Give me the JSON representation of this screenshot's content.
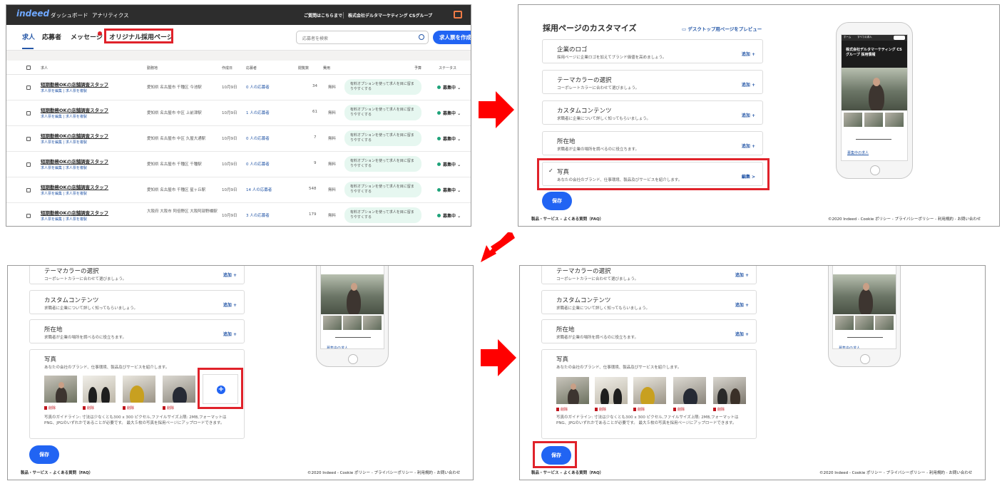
{
  "app": {
    "logo": "indeed",
    "nav": [
      "ダッシュボード",
      "アナリティクス"
    ],
    "inquiry": "ご質問はこちらまで",
    "company": "株式会社デルタマーケティング CSグループ"
  },
  "jobs_page": {
    "tabs": [
      "求人",
      "応募者",
      "メッセージ",
      "オリジナル採用ページ"
    ],
    "search_placeholder": "応募者を検索",
    "create_button": "求人票を作成",
    "columns": [
      "求人",
      "勤務地",
      "作成日",
      "応募者",
      "閲覧数",
      "費用",
      "予算",
      "ステータス"
    ],
    "rows": [
      {
        "title": "短期勤務OKの店舗調査スタッフ",
        "links": "求人票を編集 | 求人票を複製",
        "location": "愛知県 名古屋市 千種区 今池駅",
        "date": "10月9日",
        "applicants": "0 人の応募者",
        "views": "34",
        "cost": "無料",
        "budget": "有料オプションを使って求人を目に留まりやすくする",
        "status": "募集中"
      },
      {
        "title": "短期勤務OKの店舗調査スタッフ",
        "links": "求人票を編集 | 求人票を複製",
        "location": "愛知県 名古屋市 中区 上前津駅",
        "date": "10月9日",
        "applicants": "1 人の応募者",
        "views": "61",
        "cost": "無料",
        "budget": "有料オプションを使って求人を目に留まりやすくする",
        "status": "募集中"
      },
      {
        "title": "短期勤務OKの店舗調査スタッフ",
        "links": "求人票を編集 | 求人票を複製",
        "location": "愛知県 名古屋市 中区 久屋大通駅",
        "date": "10月9日",
        "applicants": "0 人の応募者",
        "views": "7",
        "cost": "無料",
        "budget": "有料オプションを使って求人を目に留まりやすくする",
        "status": "募集中"
      },
      {
        "title": "短期勤務OKの店舗調査スタッフ",
        "links": "求人票を編集 | 求人票を複製",
        "location": "愛知県 名古屋市 千種区 千種駅",
        "date": "10月9日",
        "applicants": "0 人の応募者",
        "views": "9",
        "cost": "無料",
        "budget": "有料オプションを使って求人を目に留まりやすくする",
        "status": "募集中"
      },
      {
        "title": "短期勤務OKの店舗調査スタッフ",
        "links": "求人票を編集 | 求人票を複製",
        "location": "愛知県 名古屋市 千種区 星ヶ丘駅",
        "date": "10月9日",
        "applicants": "14 人の応募者",
        "views": "548",
        "cost": "無料",
        "budget": "有料オプションを使って求人を目に留まりやすくする",
        "status": "募集中"
      },
      {
        "title": "短期勤務OKの店舗調査スタッフ",
        "links": "求人票を編集 | 求人票を複製",
        "location": "大阪府 大阪市 阿倍野区 大阪阿部野橋駅",
        "date": "10月9日",
        "applicants": "3 人の応募者",
        "views": "179",
        "cost": "無料",
        "budget": "有料オプションを使って求人を目に留まりやすくする",
        "status": "募集中"
      }
    ]
  },
  "customize": {
    "title": "採用ページのカスタマイズ",
    "preview_link": "デスクトップ用ページをプレビュー",
    "sections": [
      {
        "title": "企業のロゴ",
        "desc": "採用ページに企業ロゴを加えてブランド価値を高めましょう。",
        "action": "追加 +"
      },
      {
        "title": "テーマカラーの選択",
        "desc": "コーポレートカラーに合わせて選びましょう。",
        "action": "追加 +"
      },
      {
        "title": "カスタムコンテンツ",
        "desc": "求職者に企業について詳しく知ってもらいましょう。",
        "action": "追加 +"
      },
      {
        "title": "所在地",
        "desc": "求職者が企業の場所を調べるのに役立ちます。",
        "action": "追加 +"
      },
      {
        "title": "写真",
        "desc": "あなたの会社のブランド、仕事環境、製品及びサービスを紹介します。",
        "action": "編集 >"
      }
    ],
    "check": "✓",
    "delete_label": "削除",
    "add_symbol": "+",
    "guideline": "写真のガイドライン: 寸法は少なくとも300 x 300 ピクセル,ファイルサイズ上限: 2MB,フォーマットはPNG、JPGのいずれかであることが必要です。 最大５枚の写真を採用ページにアップロードできます。",
    "save": "保存",
    "footer_left": "製品・サービス – よくある質問（FAQ）",
    "footer_right": "©2020 Indeed - Cookie ポリシー - プライバシーポリシー - 利用規約 - お問い合わせ"
  },
  "phone_preview": {
    "home": "ホーム",
    "all_jobs": "すべての求人",
    "share": "シェア",
    "banner": "株式会社デルタマーケティング CSグループ 採用情報",
    "link": "募集中の求人"
  },
  "colors": {
    "accent": "#2164f3",
    "link": "#2557a7",
    "highlight": "#e0222a",
    "arrow": "#ff0000",
    "status": "#1fa37a"
  }
}
